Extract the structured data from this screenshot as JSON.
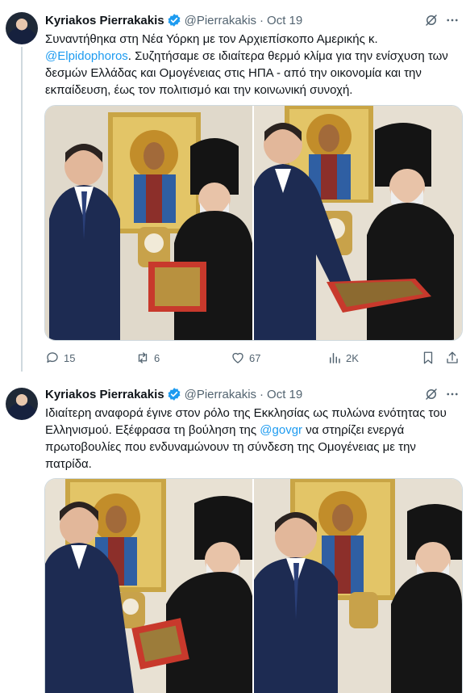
{
  "tweets": [
    {
      "author_name": "Kyriakos Pierrakakis",
      "handle": "@Pierrakakis",
      "separator": "·",
      "time": "Oct 19",
      "text_lines": [
        [
          {
            "t": "Συναντήθηκα στη Νέα Υόρκη με τον Αρχιεπίσκοπο Αμερικής κ.",
            "link": false
          }
        ],
        [
          {
            "t": "@Elpidophoros",
            "link": true
          },
          {
            "t": ". Συζητήσαμε σε ιδιαίτερα θερμό κλίμα για την ενίσχυση των",
            "link": false
          }
        ],
        [
          {
            "t": "δεσμών Ελλάδας και Ομογένειας στις ΗΠΑ - από την οικονομία και την",
            "link": false
          }
        ],
        [
          {
            "t": "εκπαίδευση, έως τον πολιτισμό και την κοινωνική συνοχή.",
            "link": false
          }
        ]
      ],
      "stats": {
        "replies": "15",
        "retweets": "6",
        "likes": "67",
        "views": "2K"
      }
    },
    {
      "author_name": "Kyriakos Pierrakakis",
      "handle": "@Pierrakakis",
      "separator": "·",
      "time": "Oct 19",
      "text_lines": [
        [
          {
            "t": "Ιδιαίτερη αναφορά έγινε στον ρόλο της Εκκλησίας ως πυλώνα ενότητας του",
            "link": false
          }
        ],
        [
          {
            "t": "Ελληνισμού. Εξέφρασα τη βούληση της ",
            "link": false
          },
          {
            "t": "@govgr",
            "link": true
          },
          {
            "t": " να στηρίζει ενεργά",
            "link": false
          }
        ],
        [
          {
            "t": "πρωτοβουλίες που ενδυναμώνουν τη σύνδεση της Ομογένειας με την",
            "link": false
          }
        ],
        [
          {
            "t": "πατρίδα.",
            "link": false
          }
        ]
      ]
    }
  ],
  "icons": {
    "verified": "verified-badge-icon",
    "grok": "grok-icon",
    "more": "more-icon",
    "reply": "reply-icon",
    "retweet": "retweet-icon",
    "like": "like-icon",
    "views": "views-icon",
    "bookmark": "bookmark-icon",
    "share": "share-icon"
  },
  "colors": {
    "link": "#1d9bf0",
    "verified": "#1d9bf0",
    "muted": "#536471",
    "icon_code_fill": "#ffffff"
  }
}
